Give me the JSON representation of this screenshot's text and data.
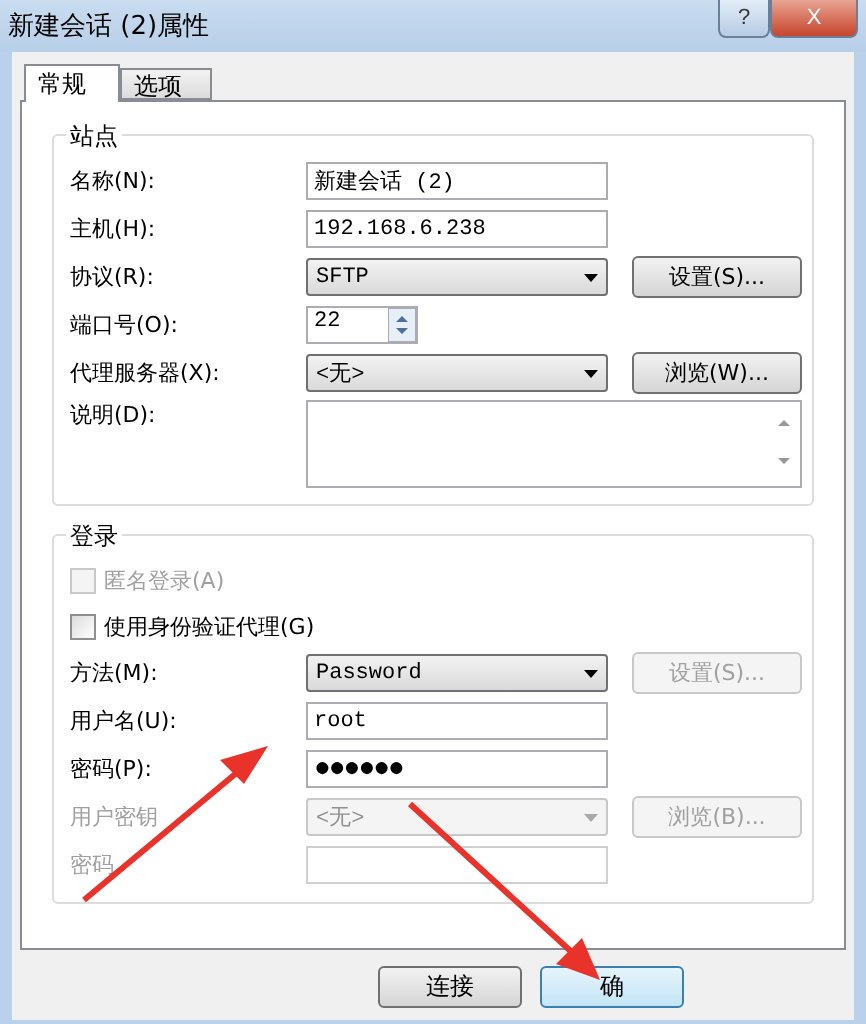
{
  "window": {
    "title": "新建会话 (2)属性",
    "buttons": [
      "?",
      "X"
    ]
  },
  "tabs": [
    {
      "label": "常规",
      "selected": true
    },
    {
      "label": "选项",
      "selected": false
    }
  ],
  "site_group": {
    "title": "站点",
    "rows": [
      {
        "kind": "text",
        "label": "名称(N):",
        "value": "新建会话 (2)"
      },
      {
        "kind": "text",
        "label": "主机(H):",
        "value": "192.168.6.238"
      },
      {
        "kind": "select",
        "label": "协议(R):",
        "value": "SFTP",
        "button": "设置(S)...",
        "disabled": false,
        "button_disabled": false
      },
      {
        "kind": "spin",
        "label": "端口号(O):",
        "value": "22"
      },
      {
        "kind": "select",
        "label": "代理服务器(X):",
        "value": "<无>",
        "button": "浏览(W)...",
        "disabled": false,
        "button_disabled": false
      },
      {
        "kind": "memo",
        "label": "说明(D):"
      }
    ]
  },
  "login_group": {
    "title": "登录",
    "rows": [
      {
        "kind": "check",
        "label": "匿名登录(A)",
        "checked": false,
        "disabled": true
      },
      {
        "kind": "check",
        "label": "使用身份验证代理(G)",
        "checked": false,
        "disabled": false
      },
      {
        "kind": "select",
        "label": "方法(M):",
        "value": "Password",
        "button": "设置(S)...",
        "disabled": false,
        "button_disabled": true
      },
      {
        "kind": "text",
        "label": "用户名(U):",
        "value": "root",
        "disabled": false
      },
      {
        "kind": "password",
        "label": "密码(P):",
        "value": "●●●●●●",
        "disabled": false
      },
      {
        "kind": "select",
        "label": "用户密钥",
        "value": "<无>",
        "button": "浏览(B)...",
        "disabled": true,
        "button_disabled": true
      },
      {
        "kind": "text",
        "label": "密码",
        "value": "",
        "disabled": true
      }
    ]
  },
  "footer_buttons": [
    {
      "label": "连接",
      "default": false
    },
    {
      "label": "确",
      "default": true
    }
  ]
}
